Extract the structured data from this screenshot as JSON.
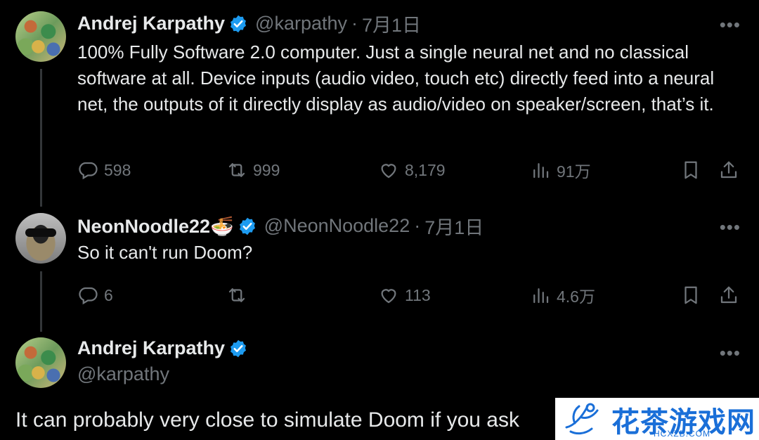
{
  "tweet1": {
    "name": "Andrej Karpathy",
    "handle": "@karpathy",
    "sep": "·",
    "date": "7月1日",
    "text": "100% Fully Software 2.0 computer. Just a single neural net and no classical software at all. Device inputs (audio video, touch etc) directly feed into a neural net, the outputs of it directly display as audio/video on speaker/screen, that’s it.",
    "replies": "598",
    "reposts": "999",
    "likes": "8,179",
    "views": "91万"
  },
  "tweet2": {
    "name": "NeonNoodle22🍜",
    "handle": "@NeonNoodle22",
    "sep": "·",
    "date": "7月1日",
    "text": "So it can't run Doom?",
    "replies": "6",
    "reposts": "",
    "likes": "113",
    "views": "4.6万"
  },
  "tweet3": {
    "name": "Andrej Karpathy",
    "handle": "@karpathy",
    "text": "It can probably very close to simulate Doom if you ask"
  },
  "watermark": {
    "text": "花茶游戏网",
    "sub": "HCXZB.COM"
  },
  "icons": {
    "more": "more-icon",
    "verified": "verified-badge-icon",
    "reply": "reply-icon",
    "repost": "repost-icon",
    "like": "like-icon",
    "views": "views-icon",
    "bookmark": "bookmark-icon",
    "share": "share-icon"
  },
  "colors": {
    "background": "#000000",
    "text": "#e7e9ea",
    "muted": "#71767b",
    "verified": "#1d9bf0"
  }
}
